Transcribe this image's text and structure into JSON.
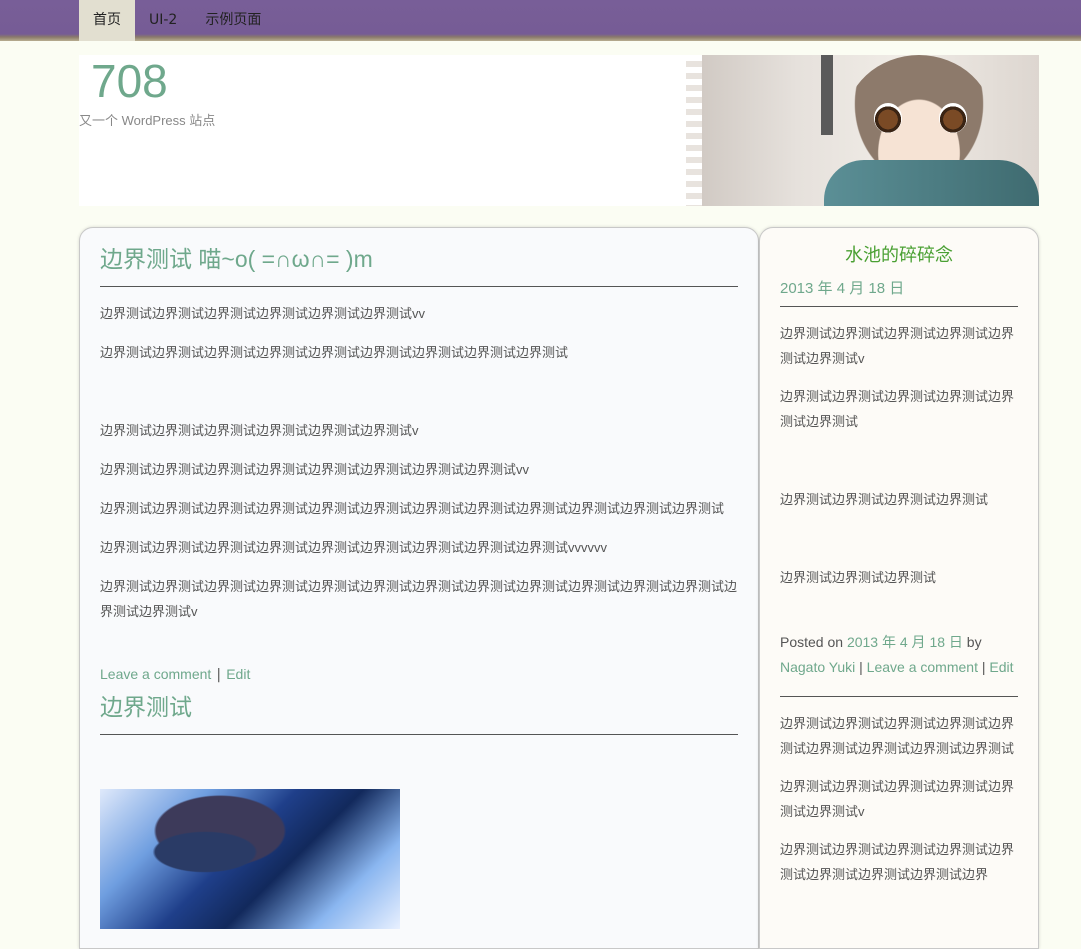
{
  "nav": {
    "items": [
      {
        "label": "首页",
        "active": true
      },
      {
        "label": "UI-2",
        "active": false
      },
      {
        "label": "示例页面",
        "active": false
      }
    ]
  },
  "header": {
    "site_title": "708",
    "site_description": "又一个 WordPress 站点"
  },
  "posts": [
    {
      "title": "边界测试 喵~o( =∩ω∩= )m",
      "paragraphs": [
        "边界测试边界测试边界测试边界测试边界测试边界测试vv",
        "边界测试边界测试边界测试边界测试边界测试边界测试边界测试边界测试边界测试",
        "边界测试边界测试边界测试边界测试边界测试边界测试v",
        "边界测试边界测试边界测试边界测试边界测试边界测试边界测试边界测试vv",
        "边界测试边界测试边界测试边界测试边界测试边界测试边界测试边界测试边界测试边界测试边界测试边界测试",
        "边界测试边界测试边界测试边界测试边界测试边界测试边界测试边界测试边界测试vvvvvv",
        "边界测试边界测试边界测试边界测试边界测试边界测试边界测试边界测试边界测试边界测试边界测试边界测试边界测试边界测试v"
      ],
      "leave_comment": "Leave a comment",
      "separator": "|",
      "edit": "Edit"
    },
    {
      "title": "边界测试"
    }
  ],
  "sidebar": {
    "title": "水池的碎碎念",
    "date": "2013 年 4 月 18 日",
    "paragraphs": [
      "边界测试边界测试边界测试边界测试边界测试边界测试v",
      "边界测试边界测试边界测试边界测试边界测试边界测试",
      "边界测试边界测试边界测试边界测试",
      "边界测试边界测试边界测试"
    ],
    "meta": {
      "posted_on": "Posted on",
      "date_link": "2013 年 4 月 18 日",
      "by": "by",
      "author": "Nagato Yuki",
      "sep": "|",
      "leave_comment": "Leave a comment",
      "edit": "Edit"
    },
    "paragraphs2": [
      "边界测试边界测试边界测试边界测试边界测试边界测试边界测试边界测试边界测试",
      "边界测试边界测试边界测试边界测试边界测试边界测试v",
      "边界测试边界测试边界测试边界测试边界测试边界测试边界测试边界测试边界"
    ]
  }
}
